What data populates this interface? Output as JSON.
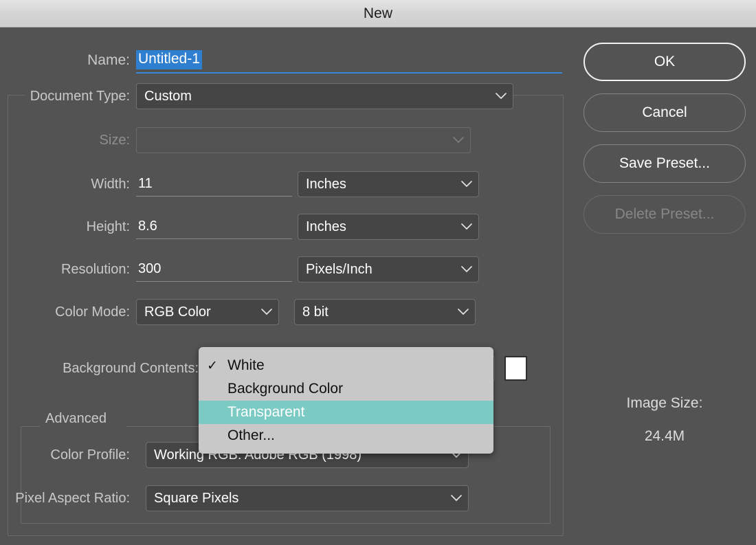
{
  "window": {
    "title": "New"
  },
  "form": {
    "name": {
      "label": "Name:",
      "value": "Untitled-1"
    },
    "document_type": {
      "label": "Document Type:",
      "value": "Custom"
    },
    "size": {
      "label": "Size:",
      "value": ""
    },
    "width": {
      "label": "Width:",
      "value": "11",
      "unit": "Inches"
    },
    "height": {
      "label": "Height:",
      "value": "8.6",
      "unit": "Inches"
    },
    "resolution": {
      "label": "Resolution:",
      "value": "300",
      "unit": "Pixels/Inch"
    },
    "color_mode": {
      "label": "Color Mode:",
      "value": "RGB Color",
      "depth": "8 bit"
    },
    "background_contents": {
      "label": "Background Contents:",
      "swatch_color": "#ffffff"
    }
  },
  "advanced": {
    "legend": "Advanced",
    "color_profile": {
      "label": "Color Profile:",
      "value": "Working RGB:  Adobe RGB (1998)"
    },
    "pixel_aspect_ratio": {
      "label": "Pixel Aspect Ratio:",
      "value": "Square Pixels"
    }
  },
  "buttons": {
    "ok": "OK",
    "cancel": "Cancel",
    "save_preset": "Save Preset...",
    "delete_preset": "Delete Preset..."
  },
  "image_size": {
    "label": "Image Size:",
    "value": "24.4M"
  },
  "popup_menu": {
    "checkmark": "✓",
    "items": [
      {
        "label": "White",
        "checked": true,
        "highlighted": false
      },
      {
        "label": "Background Color",
        "checked": false,
        "highlighted": false
      },
      {
        "label": "Transparent",
        "checked": false,
        "highlighted": true
      },
      {
        "label": "Other...",
        "checked": false,
        "highlighted": false
      }
    ]
  },
  "colors": {
    "dialog_bg": "#535353",
    "field_bg": "#454545",
    "selection_blue": "#2f7fd0",
    "menu_highlight_teal": "#7bcbc4",
    "menu_bg": "#c8c8c8"
  }
}
